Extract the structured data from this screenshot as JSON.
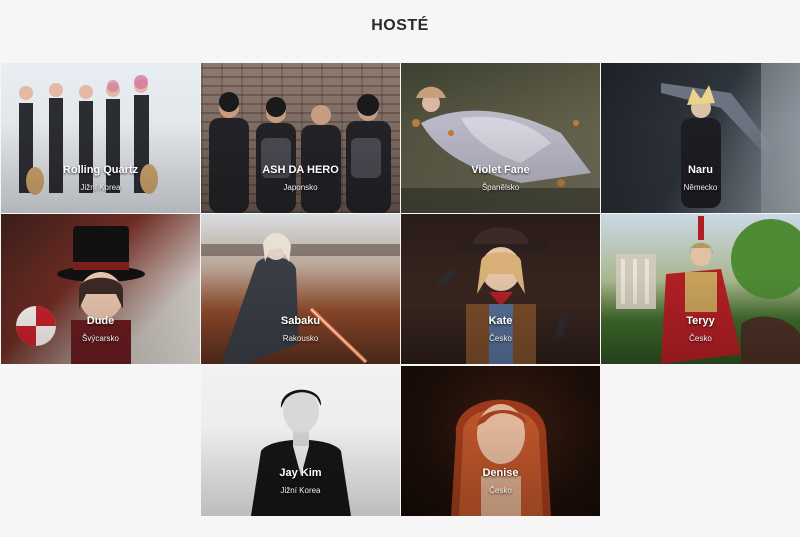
{
  "header": {
    "title": "HOSTÉ"
  },
  "guests": [
    {
      "name": "Rolling Quartz",
      "country": "Jižní Korea"
    },
    {
      "name": "ASH DA HERO",
      "country": "Japonsko"
    },
    {
      "name": "Violet Fane",
      "country": "Španělsko"
    },
    {
      "name": "Naru",
      "country": "Německo"
    },
    {
      "name": "Dude",
      "country": "Švýcarsko"
    },
    {
      "name": "Sabaku",
      "country": "Rakousko"
    },
    {
      "name": "Kate",
      "country": "Česko"
    },
    {
      "name": "Teryy",
      "country": "Česko"
    },
    {
      "name": "Jay Kim",
      "country": "Jižní Korea"
    },
    {
      "name": "Denise",
      "country": "Česko"
    }
  ]
}
